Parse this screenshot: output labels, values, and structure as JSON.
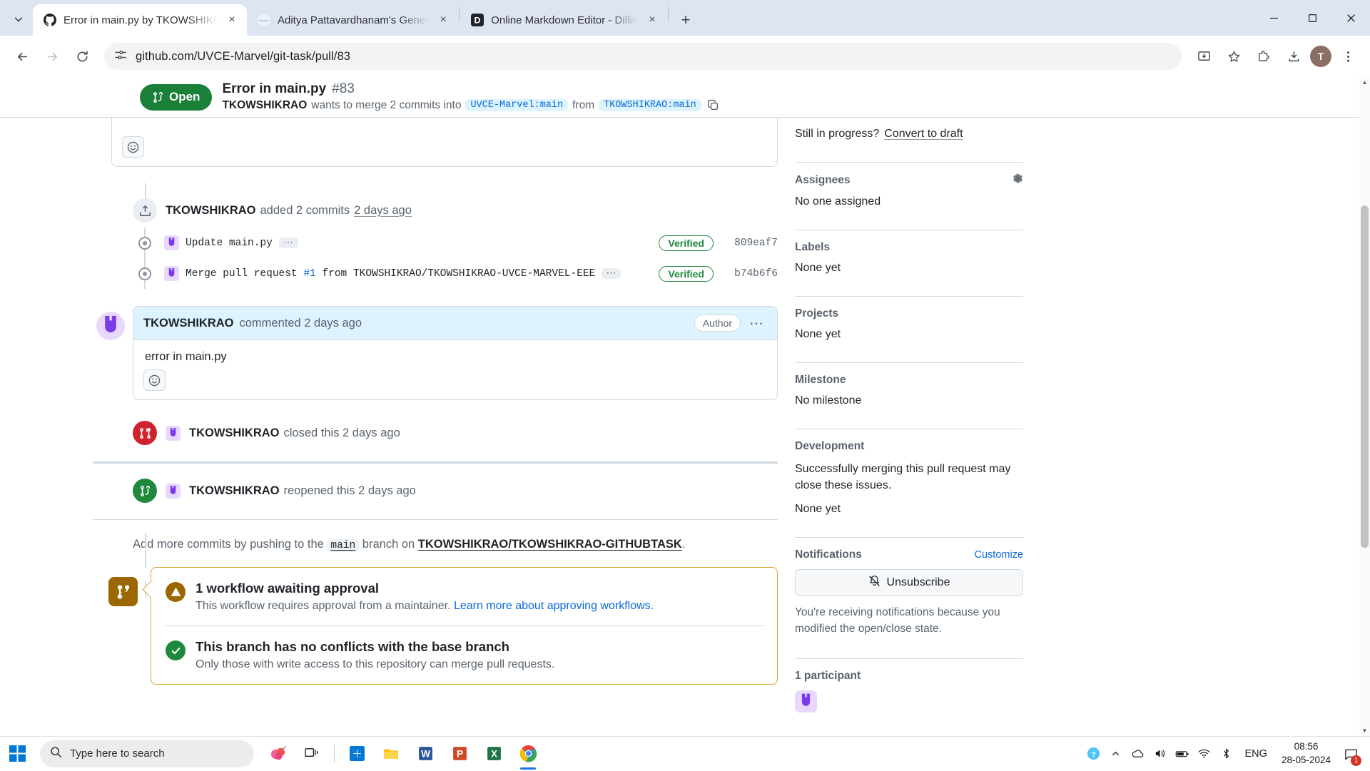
{
  "browser": {
    "tabs": [
      {
        "title": "Error in main.py by TKOWSHIKRAO",
        "favicon": "github-icon",
        "active": true
      },
      {
        "title": "Aditya Pattavardhanam's Gener",
        "favicon": "wave-icon",
        "active": false
      },
      {
        "title": "Online Markdown Editor - Dillin",
        "favicon": "dillinger-icon",
        "active": false
      }
    ],
    "new_tab_label": "+",
    "close_label": "×",
    "url": "github.com/UVCE-Marvel/git-task/pull/83",
    "profile_initial": "T",
    "back_label": "←",
    "forward_label": "→",
    "reload_label": "↻"
  },
  "pr_header": {
    "state": "Open",
    "title": "Error in main.py",
    "number": "#83",
    "author": "TKOWSHIKRAO",
    "merge_text_1": "wants to merge 2 commits into",
    "base_branch": "UVCE-Marvel:main",
    "merge_text_2": "from",
    "head_branch": "TKOWSHIKRAO:main"
  },
  "timeline": {
    "commits_event": {
      "author": "TKOWSHIKRAO",
      "action": "added 2 commits",
      "time": "2 days ago"
    },
    "commits": [
      {
        "message": "Update main.py",
        "link": "",
        "verified": "Verified",
        "sha": "809eaf7"
      },
      {
        "message": "Merge pull request ",
        "link": "#1",
        "message2": " from TKOWSHIKRAO/TKOWSHIKRAO-UVCE-MARVEL-EEE",
        "verified": "Verified",
        "sha": "b74b6f6"
      }
    ],
    "comment": {
      "author": "TKOWSHIKRAO",
      "meta": "commented 2 days ago",
      "author_pill": "Author",
      "body": "error in main.py"
    },
    "closed_event": {
      "author": "TKOWSHIKRAO",
      "action": "closed this 2 days ago"
    },
    "reopened_event": {
      "author": "TKOWSHIKRAO",
      "action": "reopened this 2 days ago"
    },
    "add_commits": {
      "prefix": "Add more commits by pushing to the",
      "branch": "main",
      "mid": "branch on",
      "repo": "TKOWSHIKRAO/TKOWSHIKRAO-GITHUBTASK",
      "suffix": "."
    },
    "merge_status": {
      "workflow_title": "1 workflow awaiting approval",
      "workflow_desc": "This workflow requires approval from a maintainer.",
      "workflow_link": "Learn more about approving workflows.",
      "conflicts_title": "This branch has no conflicts with the base branch",
      "conflicts_desc": "Only those with write access to this repository can merge pull requests."
    }
  },
  "sidebar": {
    "reviewers_note": "Still in progress?",
    "convert_draft": "Convert to draft",
    "assignees_label": "Assignees",
    "assignees_value": "No one assigned",
    "labels_label": "Labels",
    "labels_value": "None yet",
    "projects_label": "Projects",
    "projects_value": "None yet",
    "milestone_label": "Milestone",
    "milestone_value": "No milestone",
    "development_label": "Development",
    "development_desc": "Successfully merging this pull request may close these issues.",
    "development_value": "None yet",
    "notifications_label": "Notifications",
    "customize_label": "Customize",
    "unsubscribe_label": "Unsubscribe",
    "notifications_note": "You're receiving notifications because you modified the open/close state.",
    "participants_label": "1 participant"
  },
  "taskbar": {
    "search_placeholder": "Type here to search",
    "language": "ENG",
    "time": "08:56",
    "date": "28-05-2024",
    "notification_count": "1",
    "apps": [
      {
        "name": "taskview-icon"
      },
      {
        "name": "store-icon"
      },
      {
        "name": "explorer-icon"
      },
      {
        "name": "word-icon"
      },
      {
        "name": "powerpoint-icon"
      },
      {
        "name": "excel-icon"
      },
      {
        "name": "chrome-icon"
      }
    ]
  },
  "colors": {
    "open_green": "#1a7f37",
    "link_blue": "#0969da",
    "warn_yellow": "#9a6700",
    "danger_red": "#cf222e",
    "success_green": "#1f883d"
  }
}
